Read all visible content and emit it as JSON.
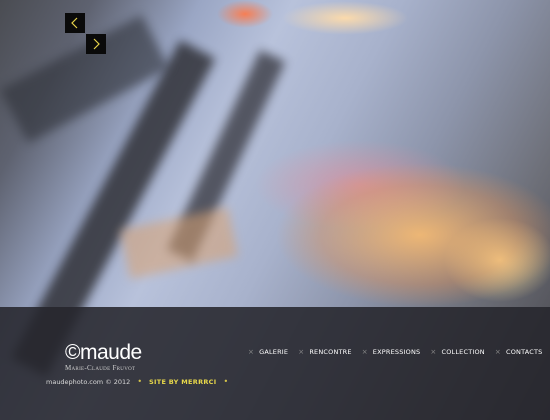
{
  "slideshow": {
    "prev_icon": "chevron-left-icon",
    "next_icon": "chevron-right-icon"
  },
  "brand": {
    "logo": "©maude",
    "tagline": "Marie-Claude Fruvot"
  },
  "footer": {
    "copyright": "maudephoto.com © 2012",
    "site_by_label": "SITE BY MERRRCI"
  },
  "menu": {
    "separator_icon": "x-icon",
    "items": [
      {
        "label": "GALERIE"
      },
      {
        "label": "RENCONTRE"
      },
      {
        "label": "EXPRESSIONS"
      },
      {
        "label": "COLLECTION"
      },
      {
        "label": "CONTACTS"
      }
    ]
  },
  "colors": {
    "accent": "#e8d84a",
    "footer_bg": "#26262c"
  }
}
